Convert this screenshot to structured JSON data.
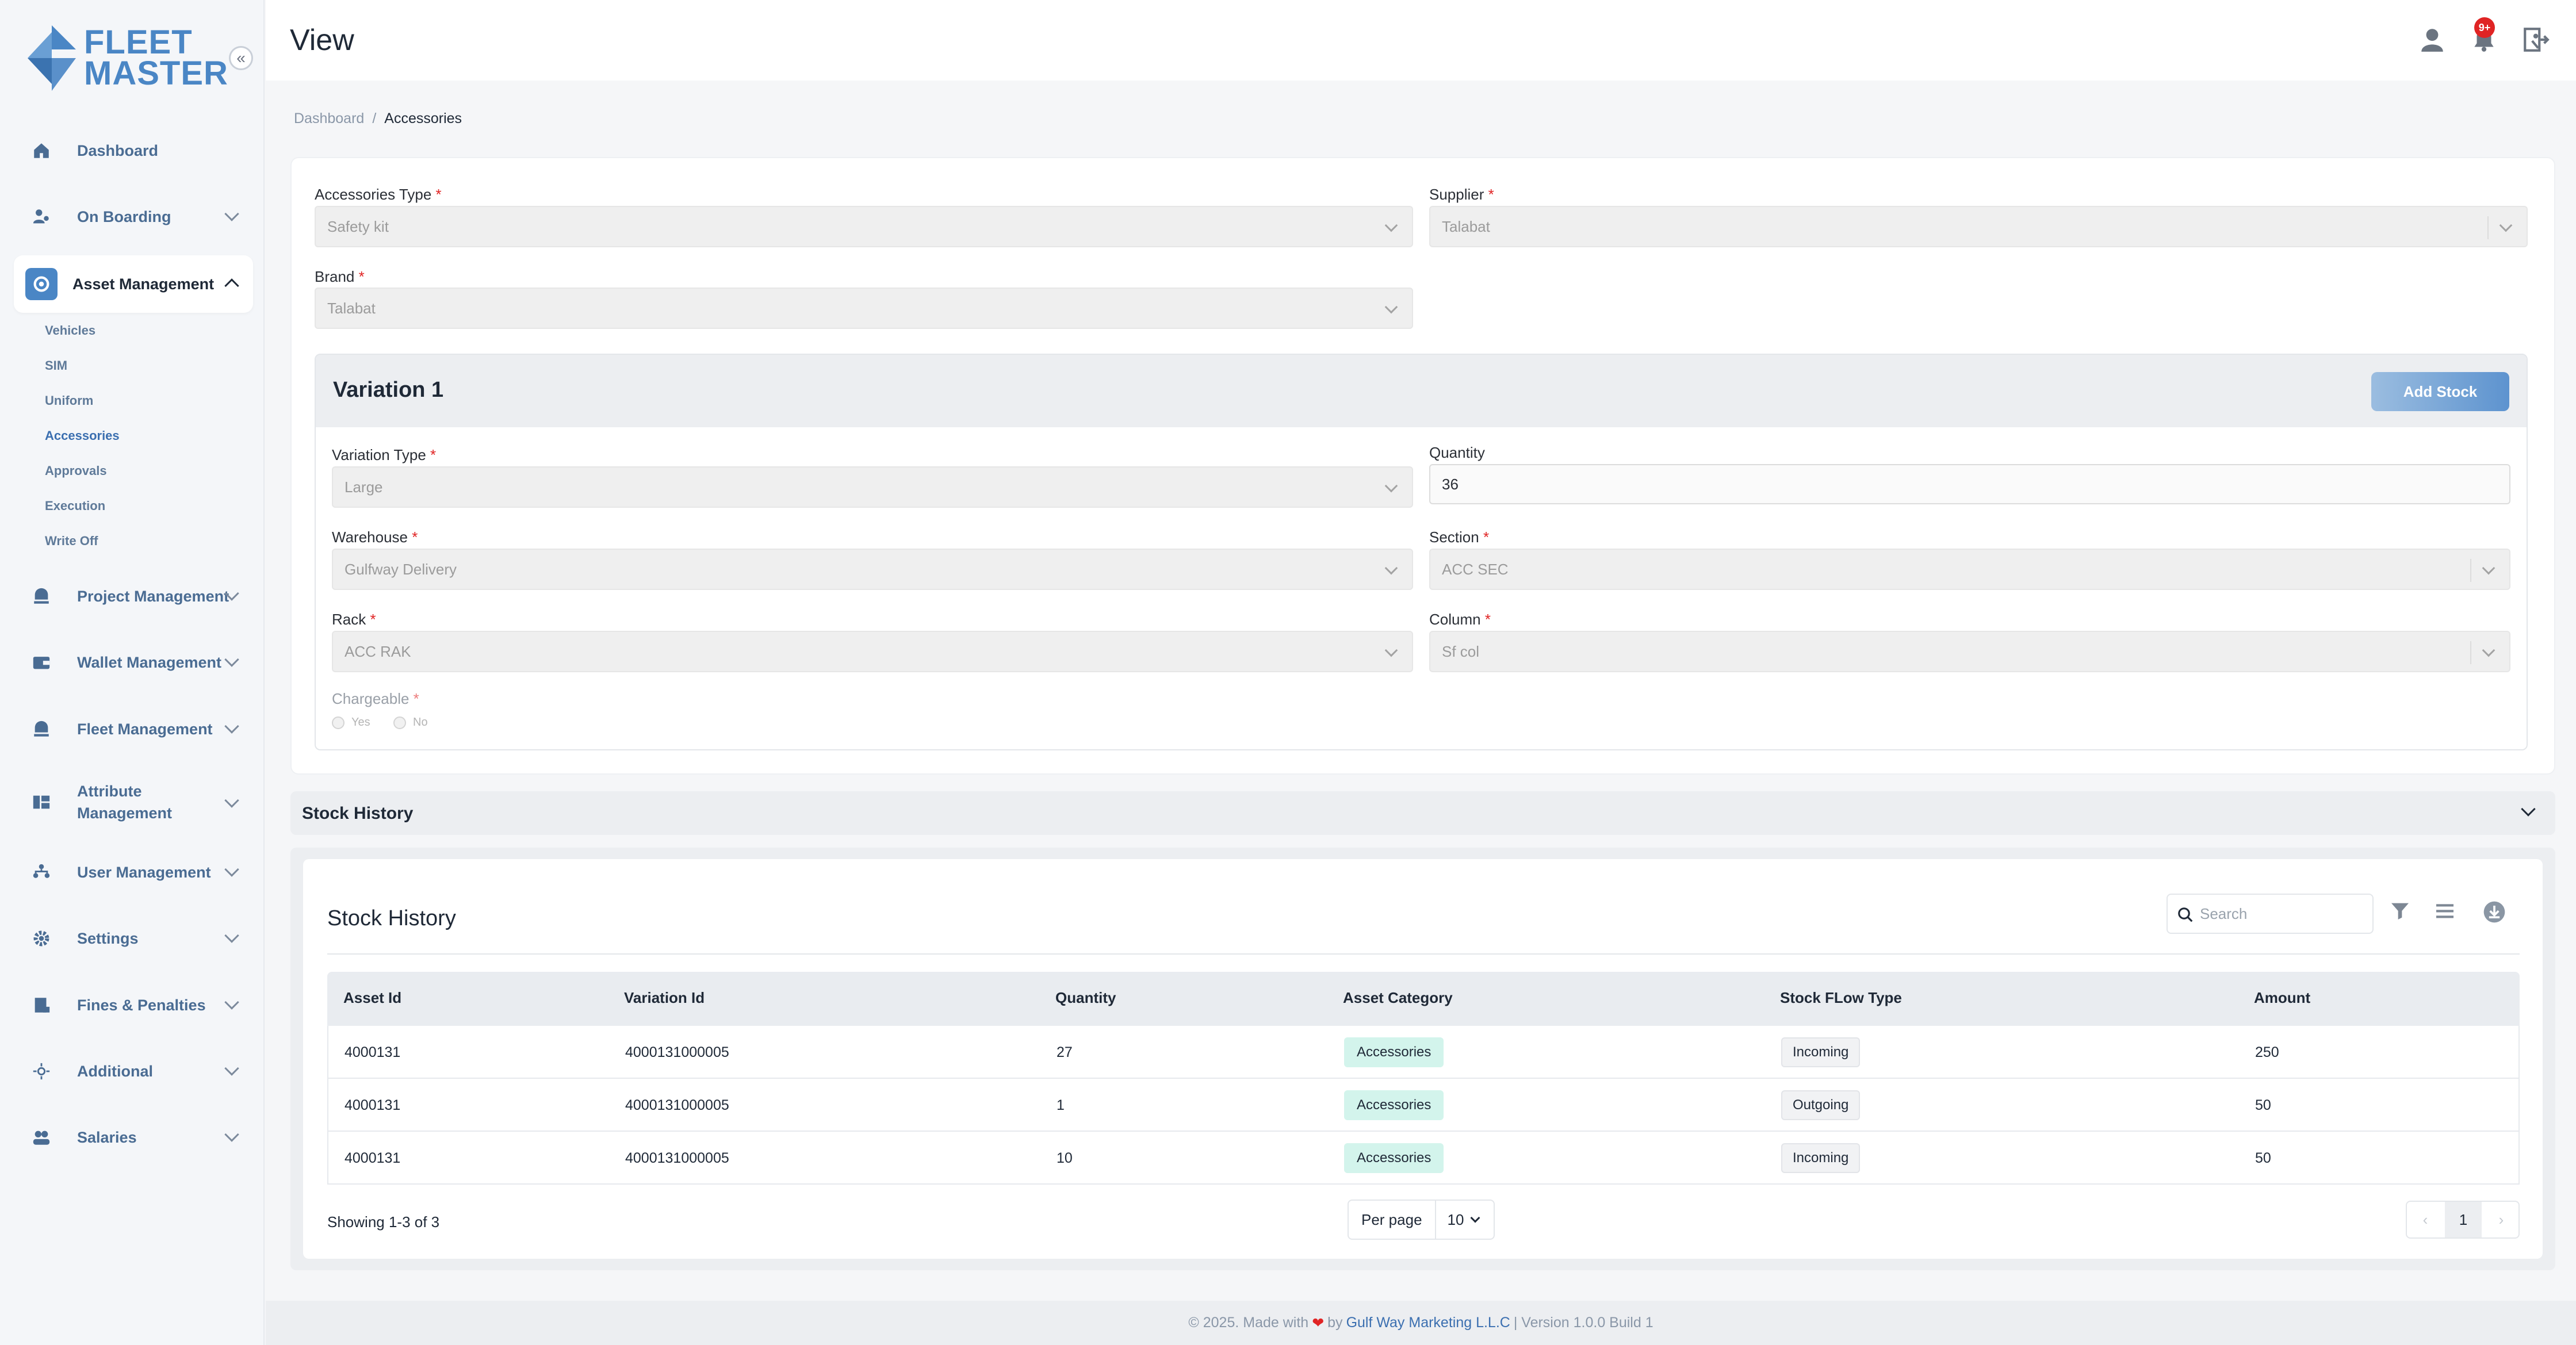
{
  "brand": {
    "line1": "FLEET",
    "line2": "MASTER",
    "color": "#4a86c5"
  },
  "sidebar": {
    "items": [
      {
        "label": "Dashboard",
        "icon": "home-icon"
      },
      {
        "label": "On Boarding",
        "icon": "onboarding-icon"
      },
      {
        "label": "Asset Management",
        "icon": "asset-icon"
      },
      {
        "label": "Project Management",
        "icon": "project-icon"
      },
      {
        "label": "Wallet Management",
        "icon": "wallet-icon"
      },
      {
        "label": "Fleet Management",
        "icon": "fleet-icon"
      },
      {
        "label": "Attribute",
        "label2": "Management",
        "icon": "attribute-icon"
      },
      {
        "label": "User Management",
        "icon": "users-icon"
      },
      {
        "label": "Settings",
        "icon": "gear-icon"
      },
      {
        "label": "Fines & Penalties",
        "icon": "fines-icon"
      },
      {
        "label": "Additional",
        "icon": "additional-icon"
      },
      {
        "label": "Salaries",
        "icon": "salaries-icon"
      }
    ],
    "asset_sub": [
      "Vehicles",
      "SIM",
      "Uniform",
      "Accessories",
      "Approvals",
      "Execution",
      "Write Off"
    ],
    "active_sub": "Accessories"
  },
  "header": {
    "title": "View",
    "notification_count": "9+"
  },
  "breadcrumb": {
    "home": "Dashboard",
    "separator": "/",
    "current": "Accessories"
  },
  "form": {
    "accessories_type": {
      "label": "Accessories Type",
      "value": "Safety kit"
    },
    "supplier": {
      "label": "Supplier",
      "value": "Talabat"
    },
    "brand": {
      "label": "Brand",
      "value": "Talabat"
    },
    "required_mark": "*"
  },
  "variation": {
    "title": "Variation 1",
    "add_stock": "Add Stock",
    "variation_type": {
      "label": "Variation Type",
      "value": "Large"
    },
    "quantity": {
      "label": "Quantity",
      "value": "36"
    },
    "warehouse": {
      "label": "Warehouse",
      "value": "Gulfway Delivery"
    },
    "section": {
      "label": "Section",
      "value": "ACC SEC"
    },
    "rack": {
      "label": "Rack",
      "value": "ACC RAK"
    },
    "column": {
      "label": "Column",
      "value": "Sf col"
    },
    "chargeable": {
      "label": "Chargeable",
      "yes": "Yes",
      "no": "No"
    }
  },
  "accordion": {
    "title": "Stock History"
  },
  "stock_history": {
    "title": "Stock History",
    "search_placeholder": "Search",
    "columns": [
      "Asset Id",
      "Variation Id",
      "Quantity",
      "Asset Category",
      "Stock FLow Type",
      "Amount"
    ],
    "rows": [
      {
        "asset_id": "4000131",
        "variation_id": "4000131000005",
        "quantity": "27",
        "category": "Accessories",
        "flow": "Incoming",
        "amount": "250"
      },
      {
        "asset_id": "4000131",
        "variation_id": "4000131000005",
        "quantity": "1",
        "category": "Accessories",
        "flow": "Outgoing",
        "amount": "50"
      },
      {
        "asset_id": "4000131",
        "variation_id": "4000131000005",
        "quantity": "10",
        "category": "Accessories",
        "flow": "Incoming",
        "amount": "50"
      }
    ],
    "showing": "Showing 1-3 of 3",
    "per_page_label": "Per page",
    "per_page_value": "10",
    "current_page": "1"
  },
  "footer": {
    "prefix": "© 2025. Made with",
    "by": "by",
    "company": "Gulf Way Marketing L.L.C",
    "version": "| Version 1.0.0 Build 1"
  }
}
